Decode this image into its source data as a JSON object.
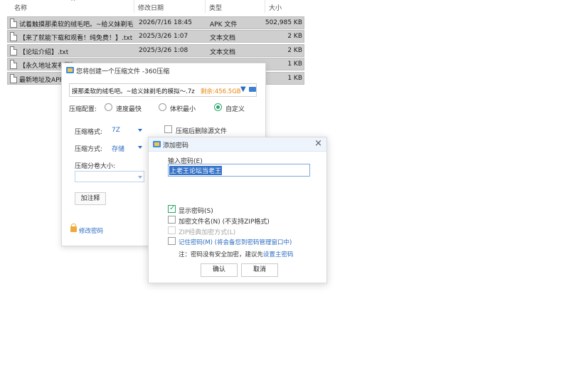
{
  "explorer": {
    "columns": {
      "name": "名称",
      "modified": "修改日期",
      "type": "类型",
      "size": "大小"
    },
    "files": [
      {
        "name": "试着触摸那柔软的绒毛吧。~给义妹剃毛...",
        "modified": "2026/7/16 18:45",
        "type": "APK 文件",
        "size": "502,985 KB"
      },
      {
        "name": "【来了就能下载和观看！纯免费！】.txt",
        "modified": "2025/3/26 1:07",
        "type": "文本文档",
        "size": "2 KB"
      },
      {
        "name": "【论坛介绍】.txt",
        "modified": "2025/3/26 1:08",
        "type": "文本文档",
        "size": "2 KB"
      },
      {
        "name": "【永久地址发布页】",
        "modified": "",
        "type": "",
        "size": "1 KB"
      },
      {
        "name": "最新地址及APP",
        "modified": "",
        "type": "",
        "size": "1 KB"
      }
    ]
  },
  "compress_dialog": {
    "title": "您将创建一个压缩文件 -360压缩",
    "path": "摸那柔软的绒毛吧。~给义妹剃毛的模拟～.7z",
    "free_space": "剩余:456.5GB",
    "config_label": "压缩配置:",
    "options": [
      "速度最快",
      "体积最小",
      "自定义"
    ],
    "format_label": "压缩格式:",
    "format_value": "7Z",
    "method_label": "压缩方式:",
    "method_value": "存储",
    "volume_label": "压缩分卷大小:",
    "delete_after_label": "压缩后删除源文件",
    "comment_button": "加注释",
    "change_password": "修改密码"
  },
  "password_dialog": {
    "title": "添加密码",
    "input_label": "输入密码(E)",
    "password_value": "上老王论坛当老王",
    "show_password": "显示密码(S)",
    "encrypt_filenames": "加密文件名(N) (不支持ZIP格式)",
    "zip_classic": "ZIP经典加密方式(L)",
    "remember_password": "记住密码(M) (将会备您到密码管理窗口中)",
    "note_prefix": "注：密码没有安全加密，建议先",
    "note_link": "设置主密码",
    "ok_button": "确认",
    "cancel_button": "取消"
  },
  "colors": {
    "accent": "#2b6cc4",
    "free_space": "#e8870e",
    "selection": "#3573c9",
    "check_green": "#2aa56b",
    "row_selected": "#cfcfcf"
  },
  "icons": [
    "file-icon",
    "app-icon",
    "close-icon",
    "folder-icon",
    "dropdown-icon",
    "lock-icon",
    "check-icon"
  ]
}
